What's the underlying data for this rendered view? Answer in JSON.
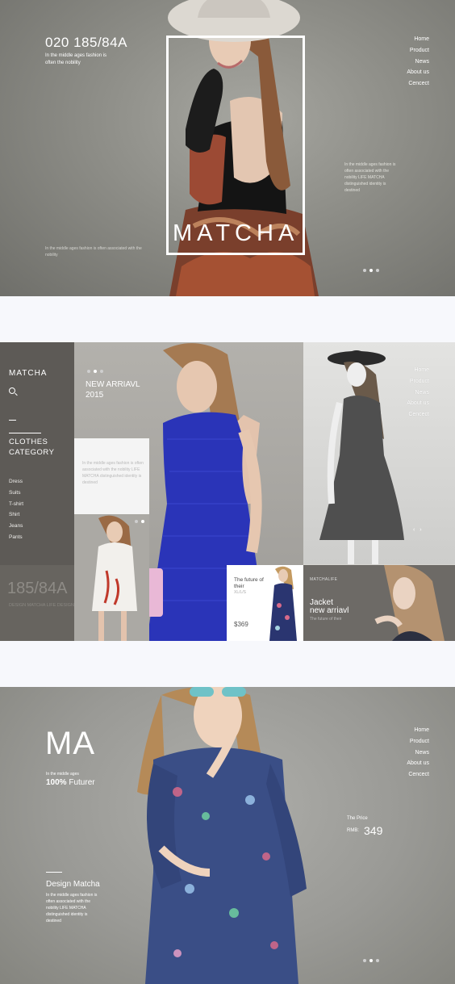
{
  "nav": [
    "Home",
    "Product",
    "News",
    "About us",
    "Cencect"
  ],
  "hero1": {
    "phone": "020 185/84A",
    "subtitle": "In the middle ages fashion is often the nobility",
    "brand": "MATCHA",
    "side_text": "In the middle ages fashion is often associated with the nobility LIFE MATCHA distinguished identity is destined",
    "footer_text": "In the middle ages fashion is often associated with the nobility"
  },
  "section2": {
    "logo": "MATCHA",
    "category_line1": "CLOTHES",
    "category_line2": "CATEGORY",
    "categories": [
      "Dress",
      "Suits",
      "T-shirt",
      "Shirt",
      "Jeans",
      "Pants"
    ],
    "size": "185/84A",
    "size_sub": "DESIGN MATCHA LIFE DESIGN",
    "new_arrival_line1": "NEW ARRIAVL",
    "new_arrival_line2": "2015",
    "card_text": "In the middle ages fashion is often associated with the nobility LIFE MATCHA distinguished identity is destined",
    "product_title": "The future of their",
    "product_sizes": "XL/L/S",
    "product_price": "$369",
    "jacket_label": "MATCHALIFE",
    "jacket_line1": "Jacket",
    "jacket_line2": "new arriavl",
    "jacket_sub": "The future of their",
    "arrows": "‹ ›"
  },
  "hero3": {
    "ma": "MA",
    "subtitle": "In the middle ages",
    "futurer_pct": "100%",
    "futurer_word": "Futurer",
    "price_label": "The Price",
    "rmb": "RMB:",
    "price": "349",
    "design": "Design Matcha",
    "description": "In the middle ages fashion is often associated with the nobility LIFE MATCHA distinguished identity is destined"
  },
  "colors": {
    "white": "#ffffff",
    "sidebar": "#5d5a56",
    "blue_dress": "#2a34b8",
    "denim": "#3a4e86"
  }
}
